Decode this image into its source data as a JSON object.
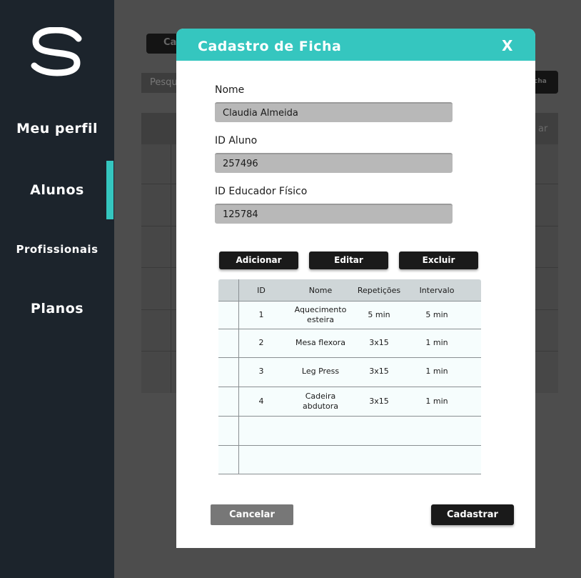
{
  "sidebar": {
    "logo_letter": "S",
    "items": [
      {
        "label": "Meu perfil"
      },
      {
        "label": "Alunos"
      },
      {
        "label": "Profissionais"
      },
      {
        "label": "Planos"
      }
    ],
    "active_item": "Alunos"
  },
  "background": {
    "top_button_partial": "Ca",
    "search_partial": "Pesqu",
    "right_button_partial": "cha",
    "table_header_partial": "ar"
  },
  "modal": {
    "title": "Cadastro de Ficha",
    "close_label": "X",
    "fields": [
      {
        "label": "Nome",
        "value": "Claudia Almeida"
      },
      {
        "label": "ID Aluno",
        "value": "257496"
      },
      {
        "label": "ID Educador Físico",
        "value": "125784"
      }
    ],
    "actions": {
      "add_label": "Adicionar",
      "edit_label": "Editar",
      "delete_label": "Excluir"
    },
    "table": {
      "columns": [
        "ID",
        "Nome",
        "Repetições",
        "Intervalo"
      ],
      "rows": [
        {
          "id": "1",
          "nome": "Aquecimento esteira",
          "repeticoes": "5 min",
          "intervalo": "5 min"
        },
        {
          "id": "2",
          "nome": "Mesa flexora",
          "repeticoes": "3x15",
          "intervalo": "1 min"
        },
        {
          "id": "3",
          "nome": "Leg Press",
          "repeticoes": "3x15",
          "intervalo": "1 min"
        },
        {
          "id": "4",
          "nome": "Cadeira abdutora",
          "repeticoes": "3x15",
          "intervalo": "1 min"
        }
      ]
    },
    "cancel_label": "Cancelar",
    "submit_label": "Cadastrar"
  },
  "colors": {
    "accent": "#35c6bf",
    "sidebar": "#1c242c",
    "button_dark": "#1a1a1a",
    "button_gray": "#777777"
  }
}
